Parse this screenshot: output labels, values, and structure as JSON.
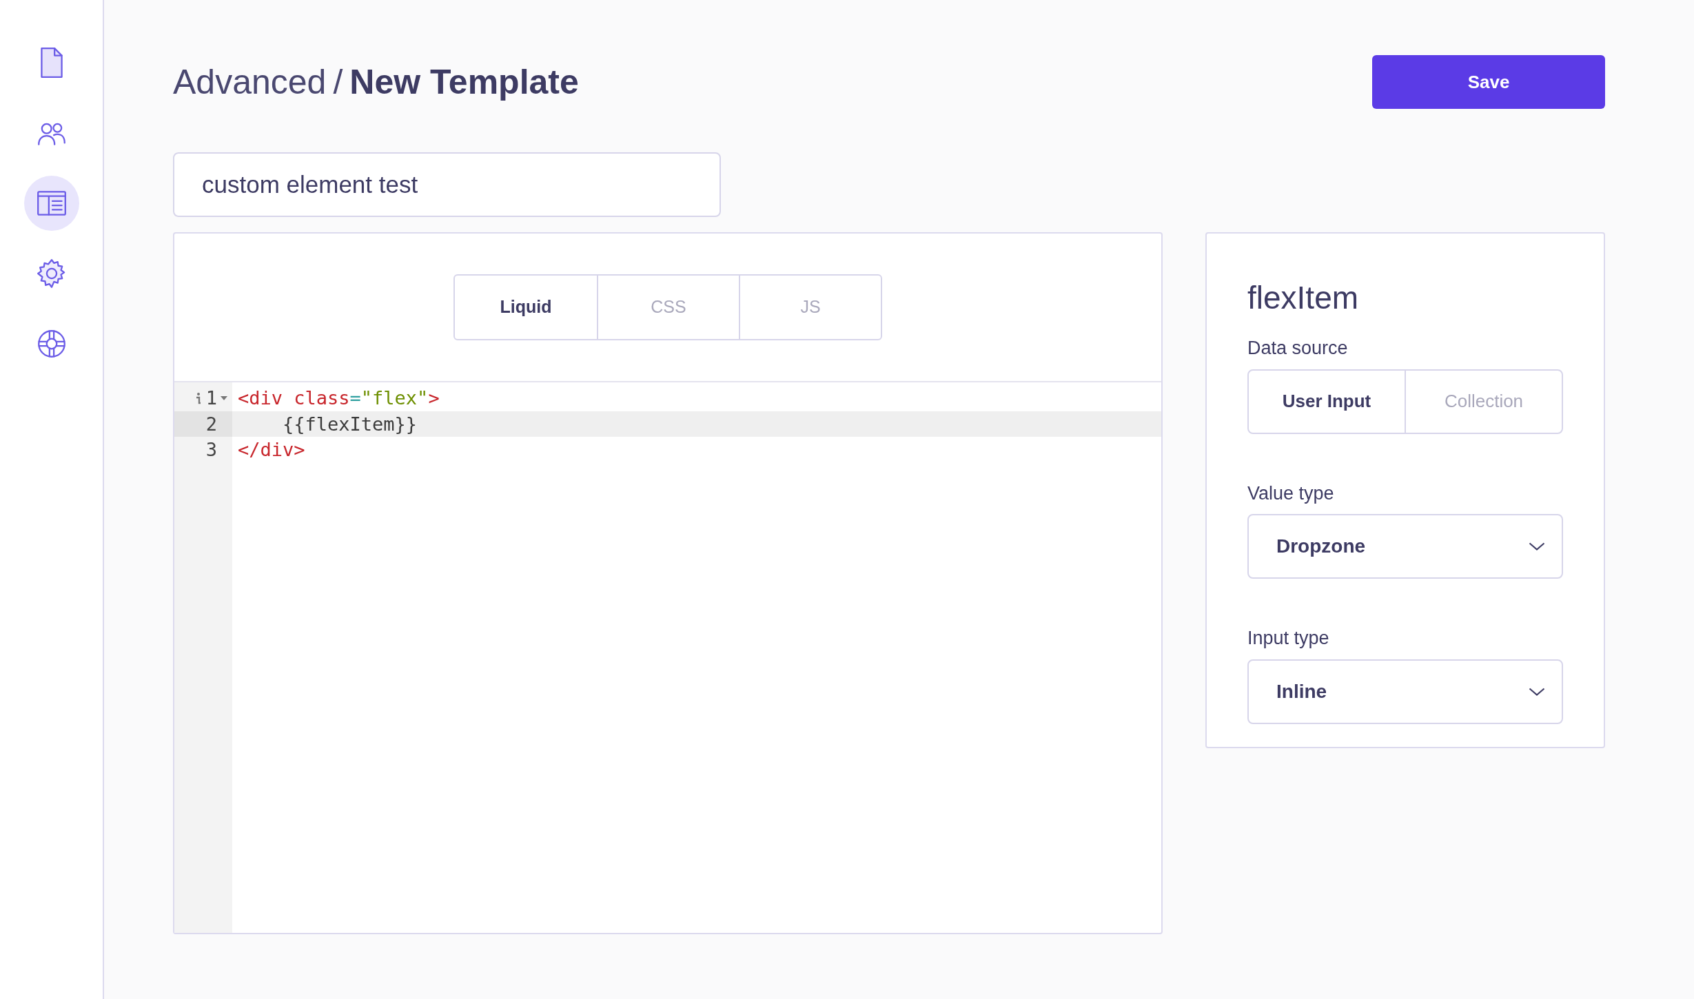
{
  "sidebar": {
    "items": [
      {
        "kind": "document",
        "selected": false
      },
      {
        "kind": "users",
        "selected": false
      },
      {
        "kind": "layout",
        "selected": true
      },
      {
        "kind": "gear",
        "selected": false
      },
      {
        "kind": "lifebuoy",
        "selected": false
      }
    ]
  },
  "header": {
    "breadcrumb_parent": "Advanced",
    "separator": "/",
    "title": "New Template",
    "save_button": "Save"
  },
  "name_field": {
    "value": "custom element test"
  },
  "editor": {
    "tabs": [
      {
        "label": "Liquid",
        "selected": true
      },
      {
        "label": "CSS",
        "selected": false
      },
      {
        "label": "JS",
        "selected": false
      }
    ],
    "lines": [
      {
        "number": "1",
        "info": true,
        "foldable": true,
        "selected": false,
        "tokens": [
          {
            "kind": "tag",
            "text": "<div"
          },
          {
            "kind": "attr",
            "text": " class"
          },
          {
            "kind": "op",
            "text": "="
          },
          {
            "kind": "string",
            "text": "\"flex\""
          },
          {
            "kind": "tag",
            "text": ">"
          }
        ]
      },
      {
        "number": "2",
        "info": false,
        "foldable": false,
        "selected": true,
        "tokens": [
          {
            "kind": "text",
            "text": "    {{flexItem}}"
          }
        ]
      },
      {
        "number": "3",
        "info": false,
        "foldable": false,
        "selected": false,
        "tokens": [
          {
            "kind": "tag",
            "text": "</div>"
          }
        ]
      }
    ]
  },
  "panel": {
    "title": "flexItem",
    "data_source": {
      "label": "Data source",
      "options": [
        {
          "label": "User Input",
          "selected": true
        },
        {
          "label": "Collection",
          "selected": false
        }
      ]
    },
    "value_type": {
      "label": "Value type",
      "value": "Dropzone"
    },
    "input_type": {
      "label": "Input type",
      "value": "Inline"
    }
  }
}
